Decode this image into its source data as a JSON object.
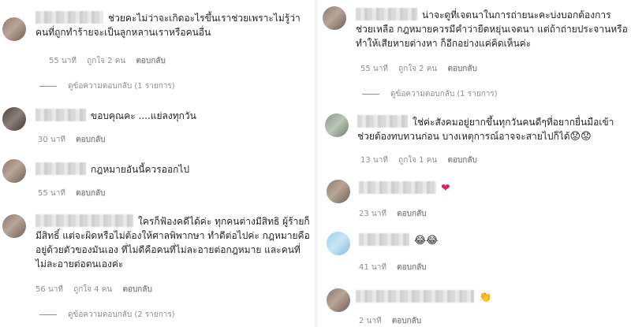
{
  "left": {
    "comments": [
      {
        "text": "ช่วยคะไม่ว่าจะเกิดอะไรขึ้นเราช่วยเพราะไม่รู้ว่าคนที่ถูกทำร้ายจะเป็นลูกหลานเราหรือคนอื่น",
        "time": "55 นาที",
        "likes": "ถูกใจ 2 คน",
        "reply": "ตอบกลับ",
        "view_replies": "ดูข้อความตอบกลับ (1 รายการ)"
      },
      {
        "text": "ขอบคุณคะ ....แย่ลงทุกวัน",
        "time": "30 นาที",
        "reply": "ตอบกลับ"
      },
      {
        "text": "กฎหมายอันนี้ควรออกไป",
        "time": "55 นาที",
        "reply": "ตอบกลับ"
      },
      {
        "text": "ใครก็ฟ้องคดีได้ค่ะ ทุกคนต่างมีสิทธิ ผู้ร้ายก็มีสิทธิ์ แต่จะผิดหรือไม่ต้องให้ศาลพิพากษา ทำดีต่อไปค่ะ กฎหมายคืออยู่ด้วยตัวของมันเอง ที่ไม่ดีคือคนที่ไม่ละอายต่อกฎหมาย และคนที่ไม่ละอายต่อตนเองค่ะ",
        "time": "56 นาที",
        "likes": "ถูกใจ 4 คน",
        "reply": "ตอบกลับ",
        "view_replies": "ดูข้อความตอบกลับ (2 รายการ)"
      }
    ]
  },
  "right": {
    "comments": [
      {
        "text": "น่าจะดูที่เจตนาในการถ่ายนะคะบ่งบอกต้องการช่วยเหลือ กฎหมายควรมีคำว่ายืดหยุ่นเจตนา แต่ถ้าถ่ายประจานหรือทำให้เสียหายต่างหา ก็อีกอย่างแค่คิดเห็นค่ะ",
        "time": "55 นาที",
        "likes": "ถูกใจ 2 คน",
        "reply": "ตอบกลับ",
        "view_replies": "ดูข้อความตอบกลับ (1 รายการ)"
      },
      {
        "text": "ใช่ค่ะสังคมอยู่ยากขึ้นทุกวันคนดีๆที่อยากยื่นมือเข้าช่วยต้องทบทวนก่อน บางเหตุการณ์อาจจะสายไปก็ได้",
        "emoji": "😟😟",
        "time": "13 นาที",
        "likes": "ถูกใจ 1 คน",
        "reply": "ตอบกลับ"
      },
      {
        "text": "",
        "emoji": "❤",
        "time": "23 นาที",
        "reply": "ตอบกลับ"
      },
      {
        "text": "",
        "emoji": "😂😂",
        "time": "41 นาที",
        "reply": "ตอบกลับ"
      },
      {
        "text": "",
        "emoji": "👏",
        "time": "2 นาที",
        "reply": "ตอบกลับ"
      }
    ]
  }
}
